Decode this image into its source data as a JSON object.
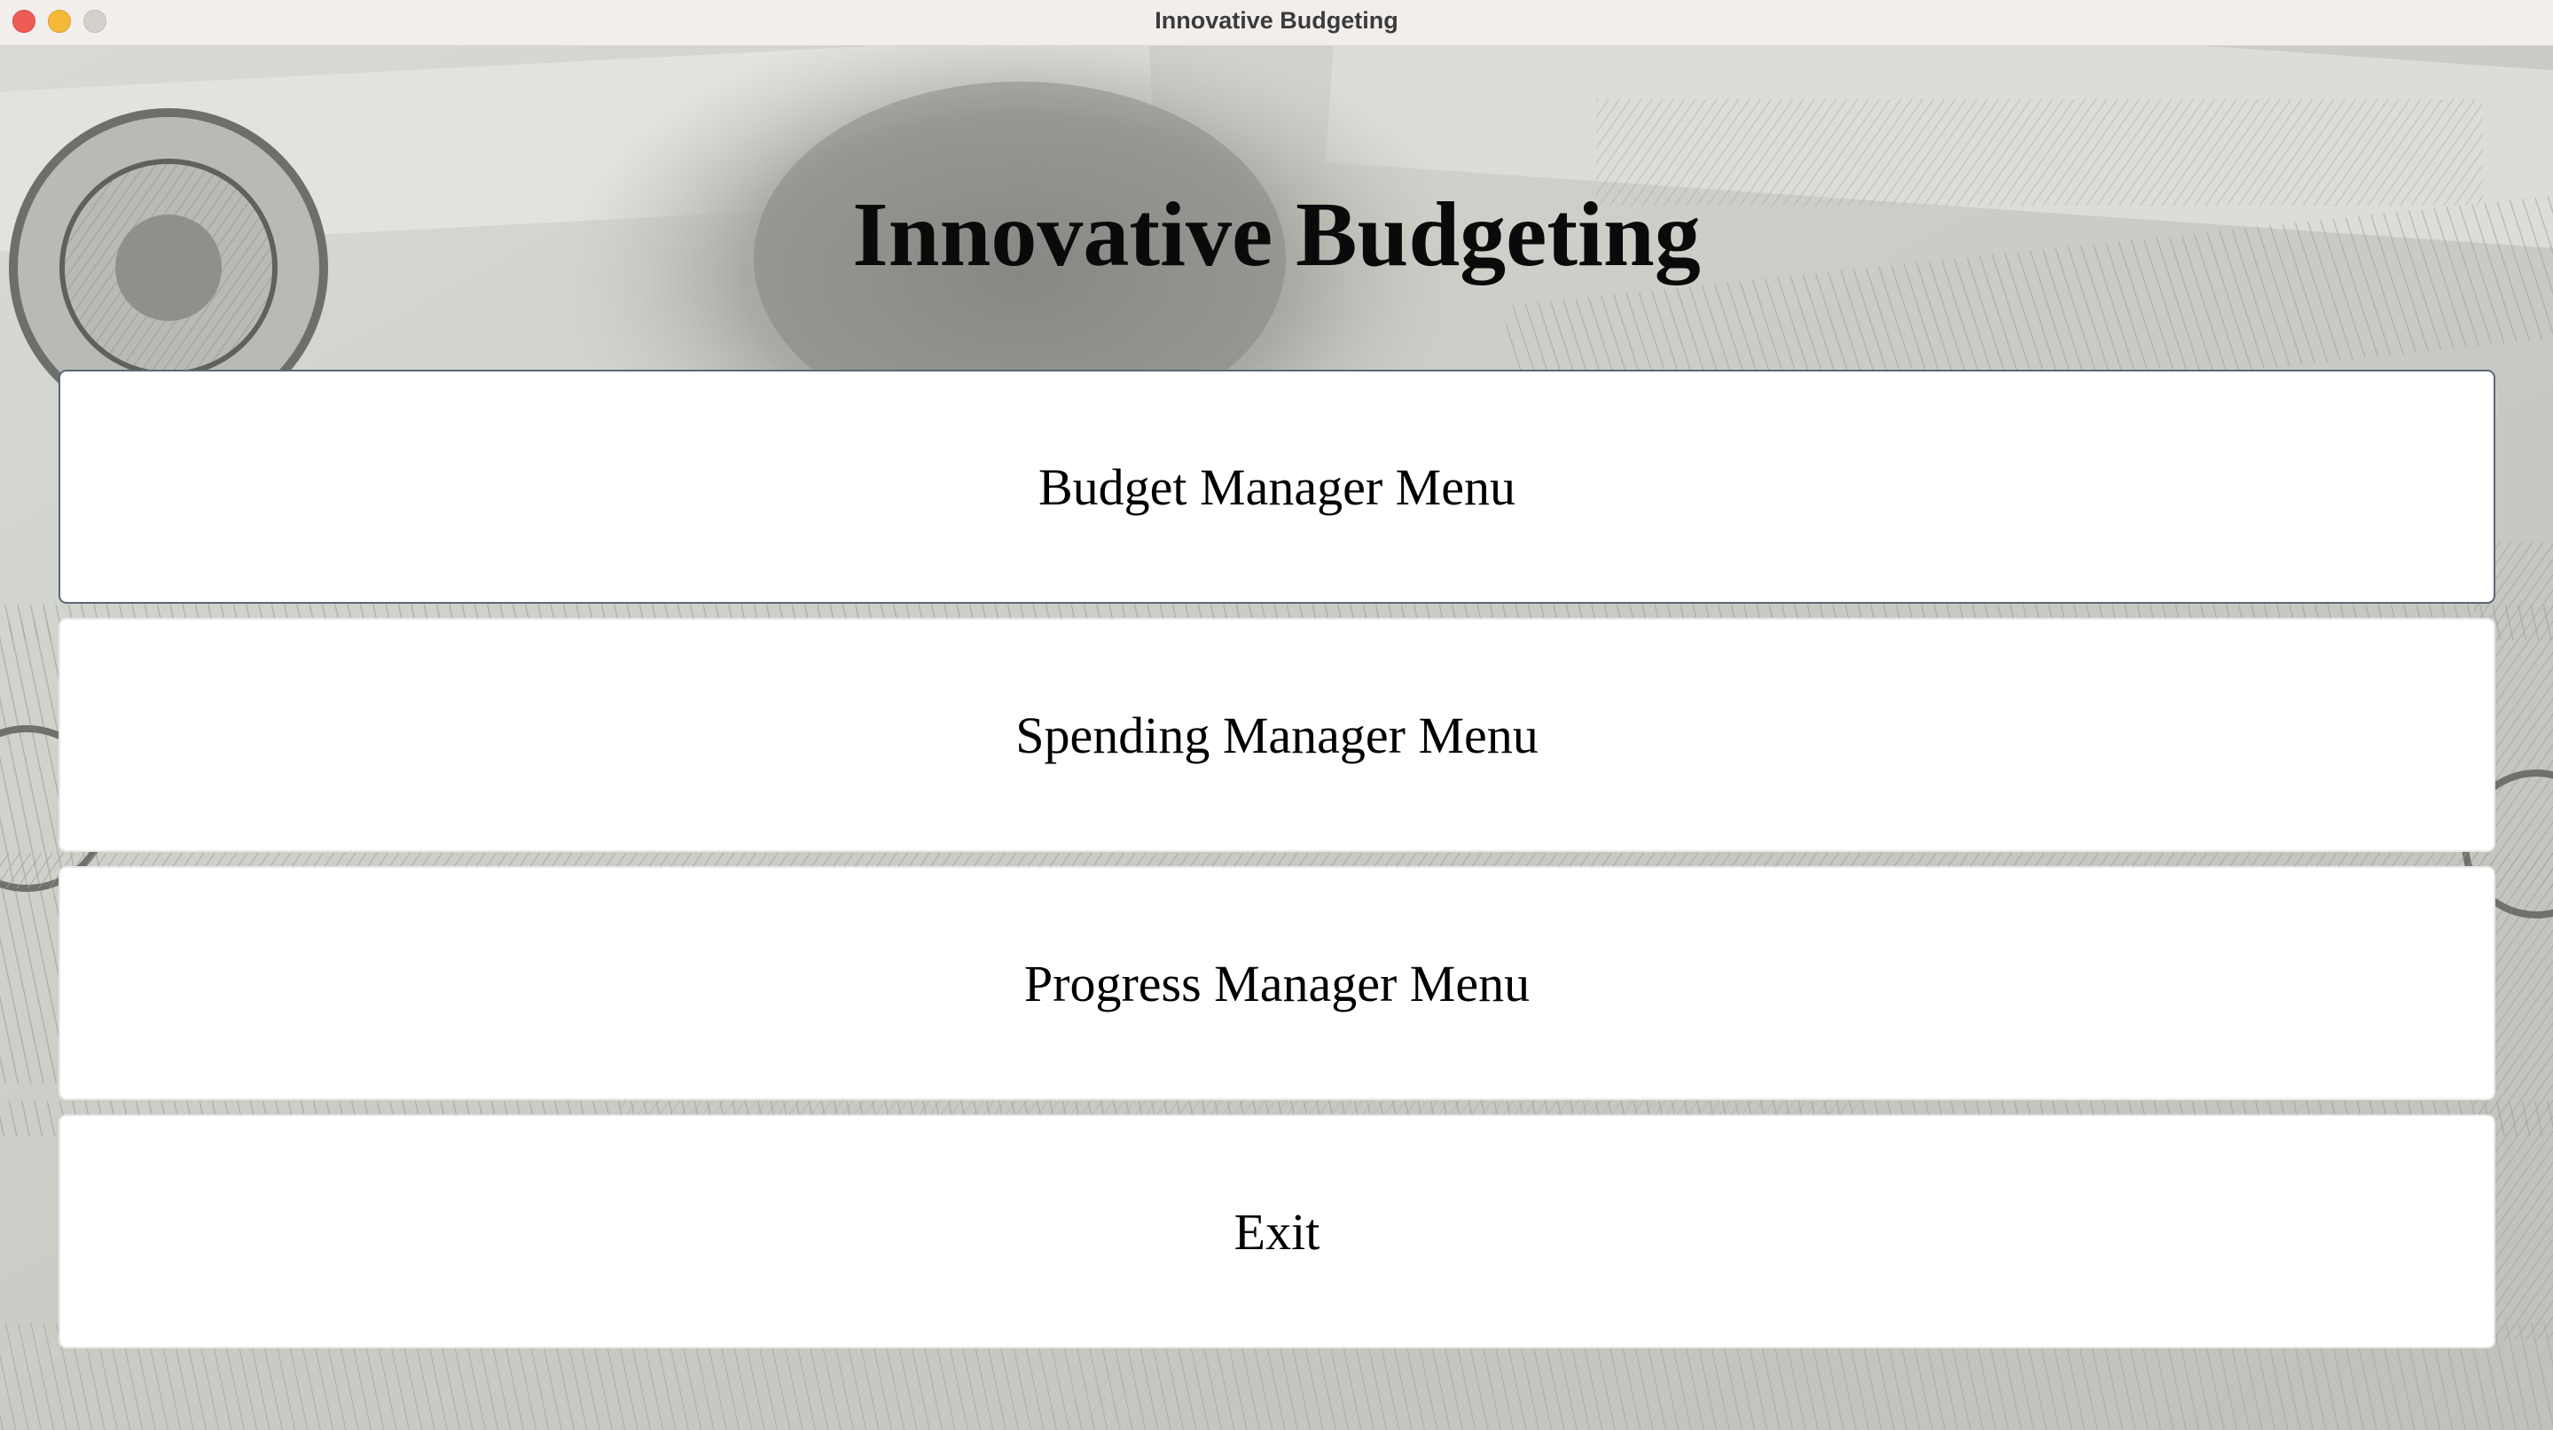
{
  "window": {
    "title": "Innovative Budgeting"
  },
  "app": {
    "heading": "Innovative Budgeting"
  },
  "menu": {
    "items": [
      {
        "label": "Budget Manager Menu"
      },
      {
        "label": "Spending Manager Menu"
      },
      {
        "label": "Progress Manager Menu"
      },
      {
        "label": "Exit"
      }
    ]
  },
  "colors": {
    "close": "#ee5d55",
    "minimize": "#f5b93a",
    "zoom": "#d3d0ce",
    "button_bg": "#ffffff"
  }
}
